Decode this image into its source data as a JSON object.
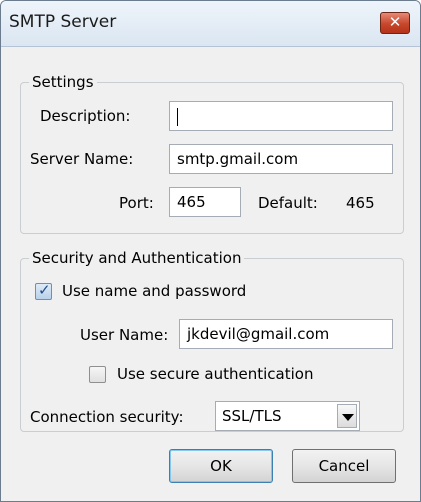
{
  "window": {
    "title": "SMTP Server",
    "close_label": "✕"
  },
  "settings": {
    "legend": "Settings",
    "description_label": "Description:",
    "description_value": "",
    "server_name_label": "Server Name:",
    "server_name_value": "smtp.gmail.com",
    "port_label": "Port:",
    "port_value": "465",
    "default_label": "Default:",
    "default_value": "465"
  },
  "security": {
    "legend": "Security and Authentication",
    "use_name_password_label": "Use name and password",
    "use_name_password_checked": true,
    "user_name_label": "User Name:",
    "user_name_value": "jkdevil@gmail.com",
    "secure_auth_label": "Use secure authentication",
    "secure_auth_checked": false,
    "connection_security_label": "Connection security:",
    "connection_security_value": "SSL/TLS"
  },
  "buttons": {
    "ok": "OK",
    "cancel": "Cancel"
  },
  "colors": {
    "titlebar": "#dbe6f2",
    "close_button": "#c7472a",
    "dialog_bg": "#f0f0f0",
    "default_button_border": "#3c7fb1"
  }
}
